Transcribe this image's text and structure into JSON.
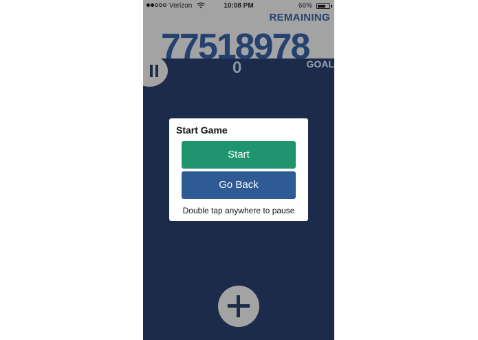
{
  "status_bar": {
    "carrier": "Verizon",
    "time": "10:08 PM",
    "battery": "66%",
    "battery_fraction": 0.66
  },
  "header": {
    "remaining_label": "REMAINING",
    "remaining_value": "77518978",
    "goal_label": "GOAL",
    "score": "0"
  },
  "modal": {
    "title": "Start Game",
    "start_label": "Start",
    "back_label": "Go Back",
    "hint": "Double tap anywhere to pause"
  },
  "colors": {
    "background": "#1b2b49",
    "panel": "#a3a3a3",
    "accent_text": "#24416f",
    "start_button": "#20946f",
    "back_button": "#2e5b95"
  },
  "icons": [
    "wifi-icon",
    "battery-icon",
    "pause-icon",
    "plus-icon"
  ]
}
